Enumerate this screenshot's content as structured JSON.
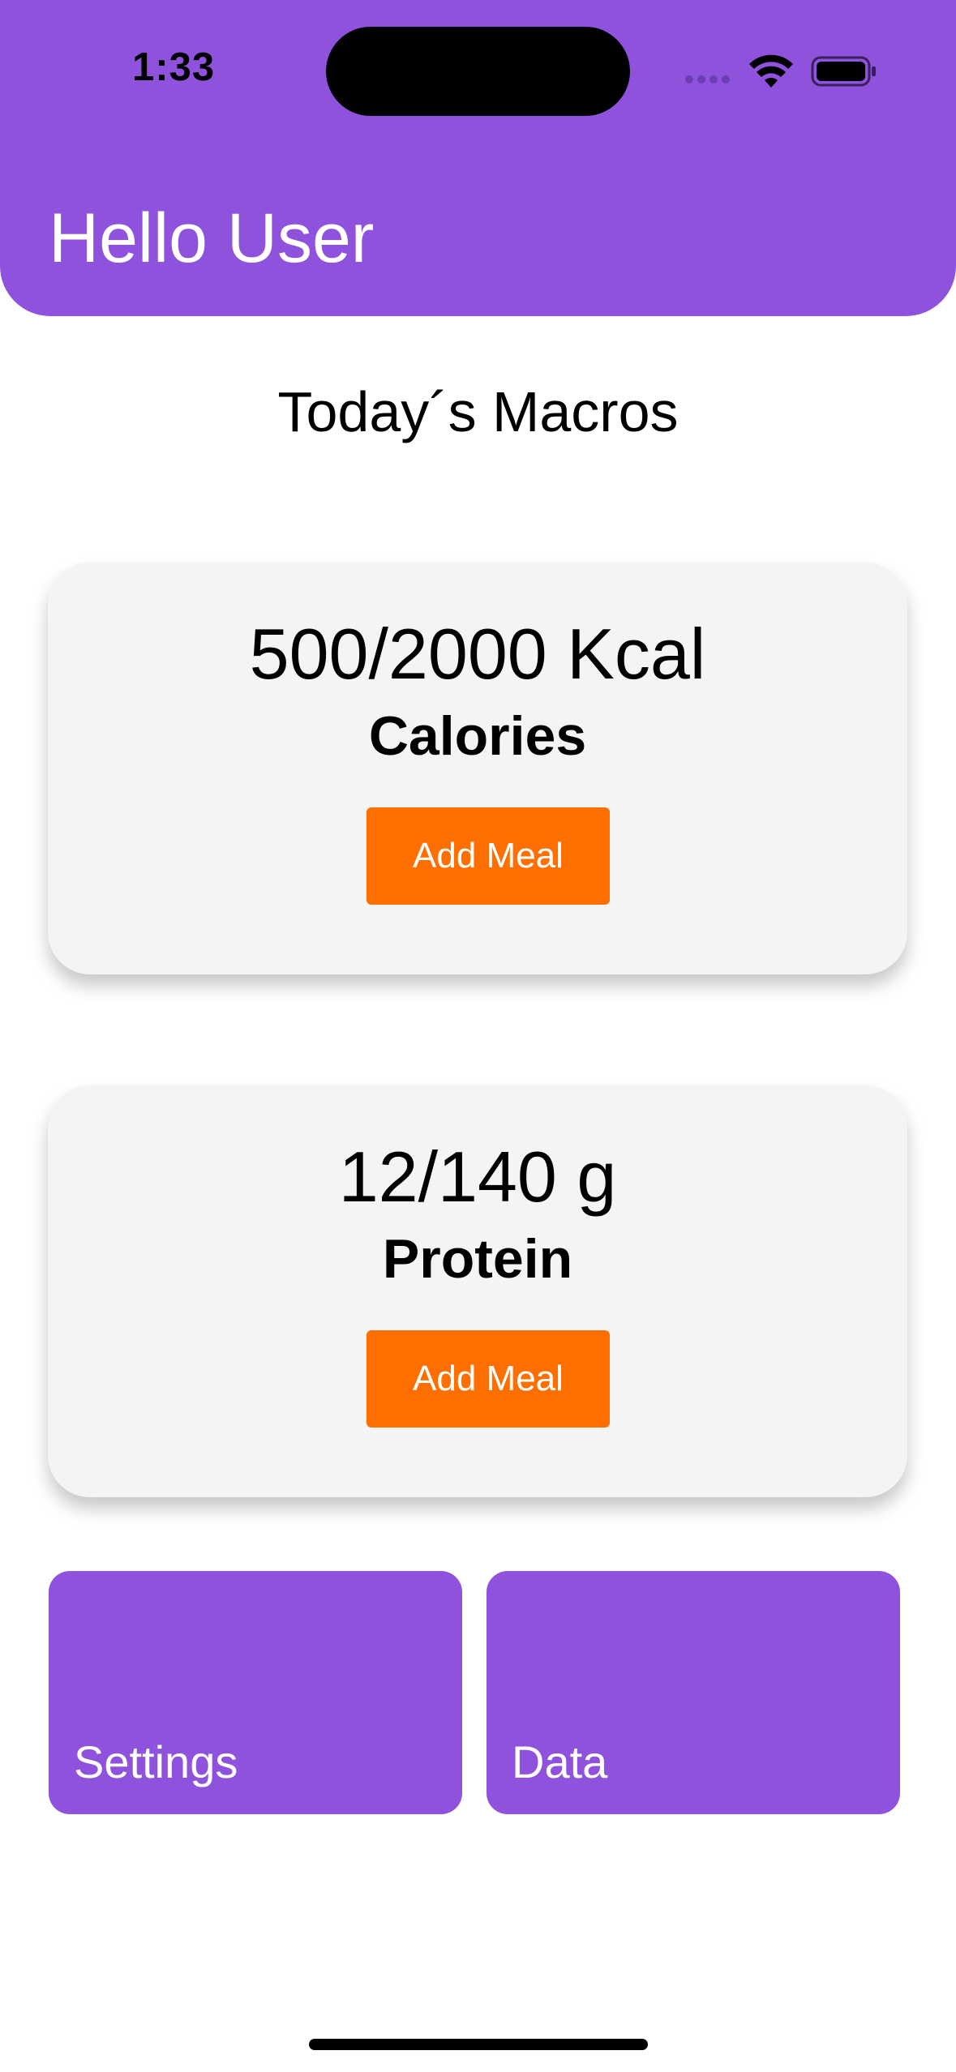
{
  "status_bar": {
    "time": "1:33",
    "icons": [
      "cellular-signal-icon",
      "wifi-icon",
      "battery-icon"
    ]
  },
  "header": {
    "title": "Hello User"
  },
  "section": {
    "title": "Today´s Macros"
  },
  "cards": {
    "calories": {
      "value": "500/2000 Kcal",
      "label": "Calories",
      "button_label": "Add Meal"
    },
    "protein": {
      "value": "12/140 g",
      "label": "Protein",
      "button_label": "Add Meal"
    }
  },
  "tiles": {
    "settings_label": "Settings",
    "data_label": "Data"
  },
  "colors": {
    "primary_purple": "#8f52dd",
    "accent_orange": "#ff6f00",
    "card_background": "#f4f4f4"
  }
}
